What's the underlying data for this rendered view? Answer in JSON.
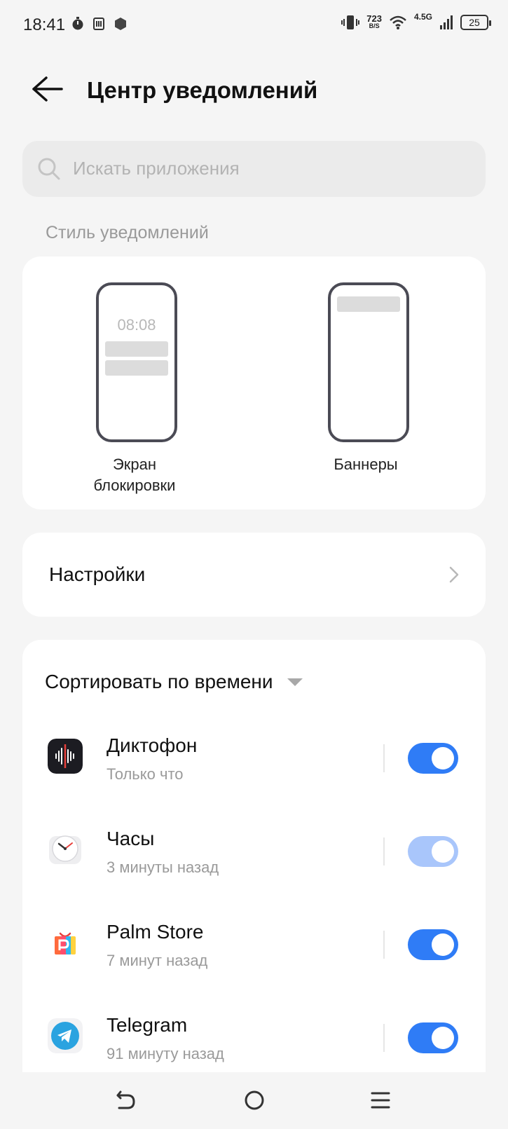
{
  "status_bar": {
    "time": "18:41",
    "speed_value": "723",
    "speed_unit": "B/S",
    "network": "4.5G",
    "battery": "25",
    "icons": [
      "timer-icon",
      "nfc-icon",
      "app-hexagon-icon",
      "vibrate-icon",
      "wifi-icon",
      "signal-icon",
      "battery-icon"
    ]
  },
  "header": {
    "title": "Центр уведомлений",
    "back_icon": "back-arrow-icon"
  },
  "search": {
    "placeholder": "Искать приложения",
    "icon": "search-icon"
  },
  "notification_style": {
    "section_label": "Стиль уведомлений",
    "options": [
      {
        "label": "Экран блокировки",
        "preview_time": "08:08"
      },
      {
        "label": "Баннеры"
      }
    ]
  },
  "settings": {
    "label": "Настройки",
    "icon": "chevron-right-icon"
  },
  "apps": {
    "sort_label": "Сортировать по времени",
    "items": [
      {
        "name": "Диктофон",
        "time": "Только что",
        "enabled": true,
        "icon": "voice-recorder-icon"
      },
      {
        "name": "Часы",
        "time": "3 минуты назад",
        "enabled": true,
        "dimmed": true,
        "icon": "clock-icon"
      },
      {
        "name": "Palm Store",
        "time": "7 минут назад",
        "enabled": true,
        "icon": "palm-store-icon"
      },
      {
        "name": "Telegram",
        "time": "91 минуту назад",
        "enabled": true,
        "icon": "telegram-icon"
      }
    ]
  },
  "colors": {
    "toggle_on": "#2f7cf6",
    "toggle_dim": "#a9c6fb",
    "background": "#f5f5f5",
    "card": "#ffffff"
  },
  "navbar": {
    "icons": [
      "back-nav-icon",
      "home-nav-icon",
      "menu-nav-icon"
    ]
  }
}
